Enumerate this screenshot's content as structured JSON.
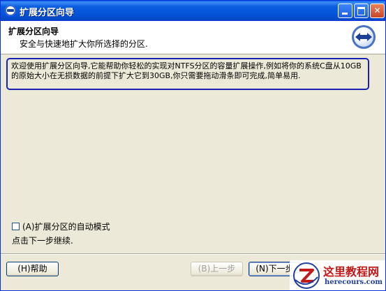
{
  "window": {
    "title": "扩展分区向导"
  },
  "header": {
    "title": "扩展分区向导",
    "subtitle": "安全与快速地扩大你所选择的分区."
  },
  "description": "欢迎使用扩展分区向导,它能帮助你轻松的实现对NTFS分区的容量扩展操作,例如将你的系统C盘从10GB的原始大小在无损数据的前提下扩大它到30GB,你只需要拖动滑条即可完成,简单易用.",
  "auto_mode": {
    "label": "(A)扩展分区的自动模式",
    "checked": false
  },
  "hint": "点击下一步继续.",
  "buttons": {
    "help": "(H)帮助",
    "prev": "(B)上一步",
    "next": "(N)下一步"
  },
  "watermark": {
    "title": "这里教程网",
    "url": "herecours.com"
  },
  "colors": {
    "titlebar": "#0553d9",
    "highlight_border": "#1a22b5",
    "watermark_red": "#c21a1a",
    "watermark_blue": "#1f3f9b"
  }
}
